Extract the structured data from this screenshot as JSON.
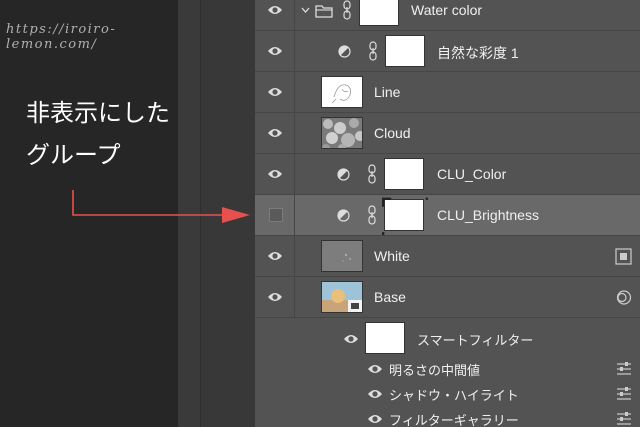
{
  "watermark": "https://iroiro-lemon.com/",
  "annotation": "非表示にした\nグループ",
  "colors": {
    "arrow": "#e8504f",
    "panel": "#535353",
    "selected": "#696969"
  },
  "layers": [
    {
      "name": "Water color",
      "kind": "group",
      "visible": true,
      "expanded": true
    },
    {
      "name": "自然な彩度 1",
      "kind": "adjustment",
      "visible": true
    },
    {
      "name": "Line",
      "kind": "pixel",
      "visible": true,
      "thumb": "sketch"
    },
    {
      "name": "Cloud",
      "kind": "pixel",
      "visible": true,
      "thumb": "cloud"
    },
    {
      "name": "CLU_Color",
      "kind": "adjustment",
      "visible": true
    },
    {
      "name": "CLU_Brightness",
      "kind": "adjustment",
      "visible": false,
      "selected": true
    },
    {
      "name": "White",
      "kind": "pixel",
      "visible": true,
      "thumb": "gray",
      "right_icon": "artboard-icon"
    },
    {
      "name": "Base",
      "kind": "smart-object",
      "visible": true,
      "thumb": "photo",
      "right_icon": "smart-object-icon"
    }
  ],
  "smart_filter_label": "スマートフィルター",
  "filters": [
    {
      "name": "明るさの中間値"
    },
    {
      "name": "シャドウ・ハイライト"
    },
    {
      "name": "フィルターギャラリー"
    }
  ]
}
